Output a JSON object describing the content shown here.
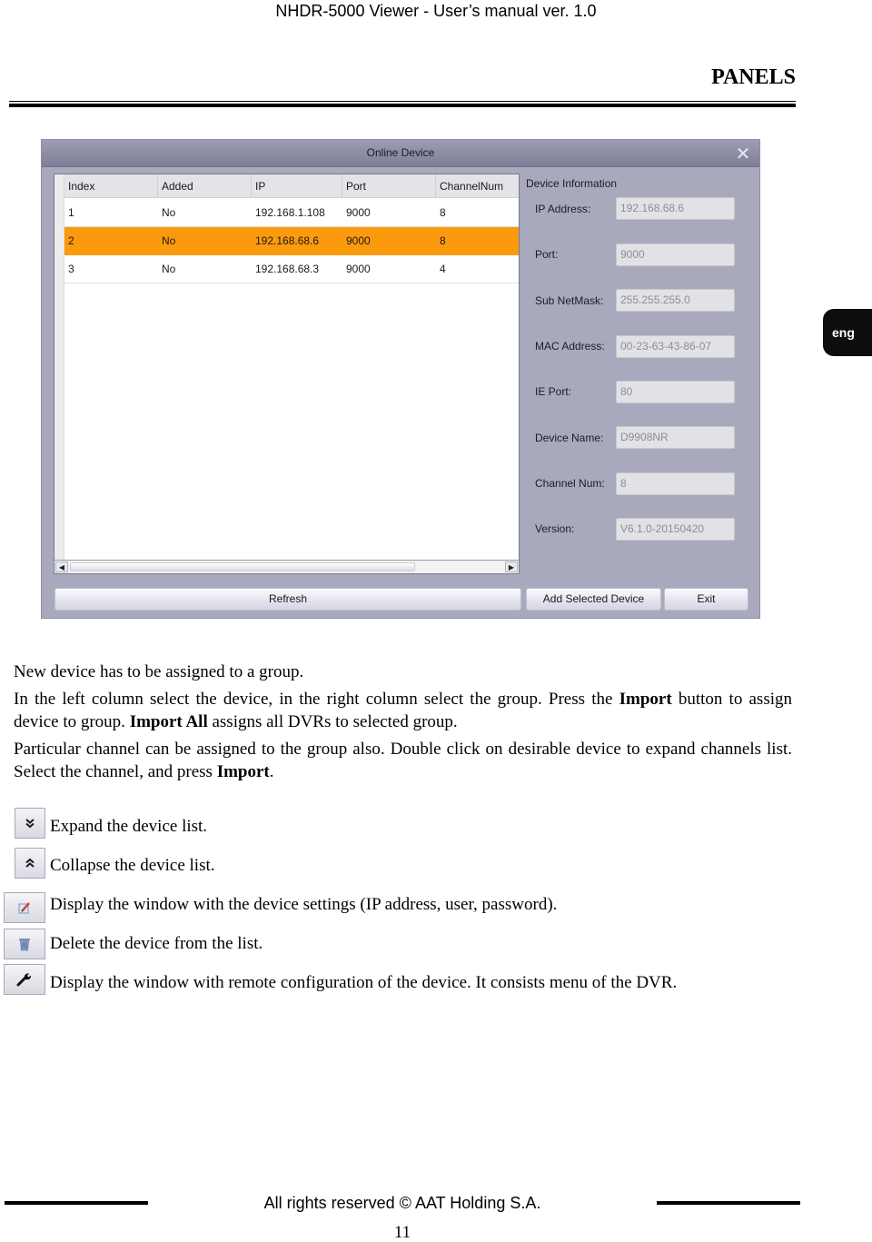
{
  "header": {
    "running_title": "NHDR-5000 Viewer - User’s manual ver. 1.0",
    "section_title": "PANELS"
  },
  "language_tab": "eng",
  "dialog": {
    "title": "Online Device",
    "close_icon": "close-x",
    "table": {
      "columns": [
        "Index",
        "Added",
        "IP",
        "Port",
        "ChannelNum"
      ],
      "rows": [
        {
          "index": "1",
          "added": "No",
          "ip": "192.168.1.108",
          "port": "9000",
          "channels": "8",
          "selected": false
        },
        {
          "index": "2",
          "added": "No",
          "ip": "192.168.68.6",
          "port": "9000",
          "channels": "8",
          "selected": true
        },
        {
          "index": "3",
          "added": "No",
          "ip": "192.168.68.3",
          "port": "9000",
          "channels": "4",
          "selected": false
        }
      ],
      "selected_row_color": "#fb9a0c"
    },
    "device_info": {
      "title": "Device Information",
      "fields": [
        {
          "label": "IP Address:",
          "value": "192.168.68.6"
        },
        {
          "label": "Port:",
          "value": "9000"
        },
        {
          "label": "Sub NetMask:",
          "value": "255.255.255.0"
        },
        {
          "label": "MAC Address:",
          "value": "00-23-63-43-86-07"
        },
        {
          "label": "IE Port:",
          "value": "80"
        },
        {
          "label": "Device Name:",
          "value": "D9908NR"
        },
        {
          "label": "Channel Num:",
          "value": "8"
        },
        {
          "label": "Version:",
          "value": "V6.1.0-20150420"
        }
      ]
    },
    "buttons": {
      "refresh": "Refresh",
      "add_selected": "Add Selected Device",
      "exit": "Exit"
    }
  },
  "body": {
    "p1": "New device has to be assigned to a group.",
    "p2_a": "In the left column select the device, in the right column select the group. Press the ",
    "p2_b": "Import",
    "p2_c": " button to assign device to group. ",
    "p2_d": "Import All",
    "p2_e": " assigns all DVRs to selected group.",
    "p3_a": "Particular channel can be assigned to the group also. Double click on desirable device to expand channels list. Select the channel, and press ",
    "p3_b": "Import",
    "p3_c": "."
  },
  "legend": [
    {
      "icon": "expand-double-chevron-down",
      "text": "Expand the device list."
    },
    {
      "icon": "collapse-double-chevron-up",
      "text": "Collapse the device list."
    },
    {
      "icon": "edit-pencil",
      "text": "Display the window with the device settings (IP address, user, password)."
    },
    {
      "icon": "trash-bin",
      "text": "Delete the device from the list."
    },
    {
      "icon": "wrench",
      "text": "Display the window with remote configuration of the device. It consists menu of the DVR."
    }
  ],
  "footer": {
    "copyright": "All rights reserved © AAT Holding S.A.",
    "page_number": "11"
  }
}
